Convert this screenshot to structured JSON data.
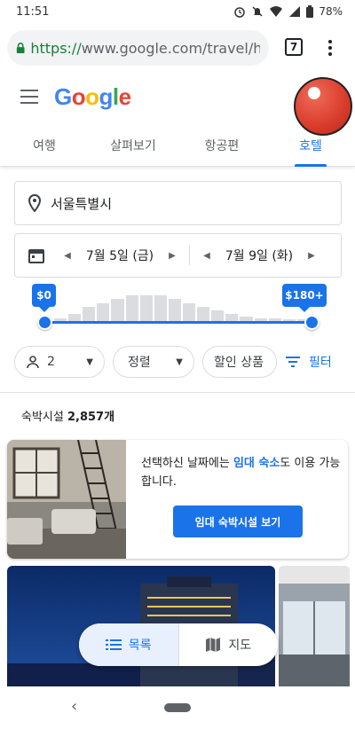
{
  "status_bar": {
    "time": "11:51",
    "battery": "78%"
  },
  "browser": {
    "url_scheme": "https://",
    "url_rest": "www.google.com/travel/hotels",
    "tab_count": "7"
  },
  "header": {
    "logo": [
      {
        "char": "G",
        "color": "#4285F4"
      },
      {
        "char": "o",
        "color": "#EA4335"
      },
      {
        "char": "o",
        "color": "#FBBC05"
      },
      {
        "char": "g",
        "color": "#4285F4"
      },
      {
        "char": "l",
        "color": "#34A853"
      },
      {
        "char": "e",
        "color": "#EA4335"
      }
    ]
  },
  "tabs": [
    {
      "label": "여행"
    },
    {
      "label": "살펴보기"
    },
    {
      "label": "항공편"
    },
    {
      "label": "호텔",
      "active": true
    }
  ],
  "search": {
    "location": "서울특별시",
    "check_in": "7월 5일 (금)",
    "check_out": "7월 9일 (화)"
  },
  "price": {
    "min_label": "$0",
    "max_label": "$180+",
    "min_fraction": 0,
    "max_fraction": 1,
    "histogram": [
      1,
      2,
      4,
      5,
      6,
      7,
      7,
      7,
      6,
      5,
      4,
      3,
      2,
      1.5,
      1,
      1,
      0.8,
      0.6
    ]
  },
  "filters": {
    "guests": "2",
    "sort": "정렬",
    "deals": "할인 상품",
    "filter_link": "필터"
  },
  "results": {
    "count_prefix": "숙박시설",
    "count_value": "2,857개"
  },
  "promo": {
    "text_before": "선택하신 날짜에는 ",
    "text_highlight": "임대 숙소",
    "text_after": "도 이용 가능합니다.",
    "button": "임대 숙박시설 보기"
  },
  "view_toggle": {
    "list": "목록",
    "map": "지도"
  },
  "colors": {
    "accent": "#1a73e8",
    "avatar": "#d93b2b"
  }
}
